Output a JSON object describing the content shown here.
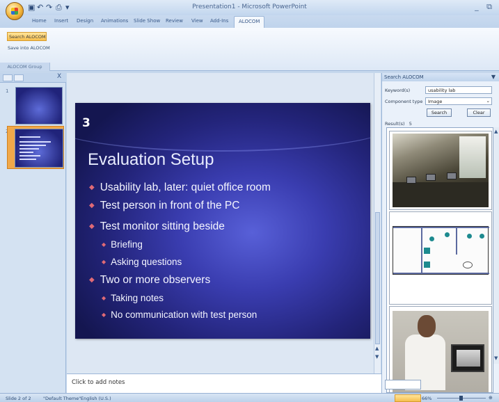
{
  "window": {
    "title": "Presentation1 - Microsoft PowerPoint",
    "controls": "_ ⧉"
  },
  "quick_access": {
    "save_icon": "save-icon",
    "undo_icon": "undo-icon",
    "redo_icon": "redo-icon"
  },
  "tabs": [
    "Home",
    "Insert",
    "Design",
    "Animations",
    "Slide Show",
    "Review",
    "View",
    "Add-Ins",
    "ALOCOM"
  ],
  "active_tab": "ALOCOM",
  "ribbon": {
    "search_button": "Search ALOCOM",
    "save_button": "Save into ALOCOM",
    "group_label": "ALOCOM Group"
  },
  "slide_panel": {
    "slides": [
      {
        "number": "1"
      },
      {
        "number": "2"
      }
    ],
    "close": "X"
  },
  "slide": {
    "number": "3",
    "title": "Evaluation Setup",
    "bullets": [
      {
        "level": 1,
        "text": "Usability lab, later: quiet office room"
      },
      {
        "level": 1,
        "text": "Test person in front of the PC"
      },
      {
        "level": 1,
        "text": "Test monitor sitting beside"
      },
      {
        "level": 2,
        "text": "Briefing"
      },
      {
        "level": 2,
        "text": "Asking questions"
      },
      {
        "level": 1,
        "text": "Two or more observers"
      },
      {
        "level": 2,
        "text": "Taking notes"
      },
      {
        "level": 2,
        "text": "No communication with test person"
      }
    ]
  },
  "notes": {
    "placeholder": "Click to add notes"
  },
  "search_pane": {
    "title": "Search ALOCOM",
    "keyword_label": "Keyword(s)",
    "keyword_value": "usability lab",
    "component_label": "Component type",
    "component_value": "Image",
    "search_button": "Search",
    "clear_button": "Clear",
    "results_label": "Result(s)",
    "results_count": "5"
  },
  "status": {
    "slide": "Slide 2 of 2",
    "theme": "\"Default Theme\"",
    "language": "English (U.S.)",
    "zoom": "66%"
  },
  "colors": {
    "slide_bg": "#2a2c8a",
    "bullet": "#e06a76",
    "ribbon_active": "#f7bf4d"
  }
}
